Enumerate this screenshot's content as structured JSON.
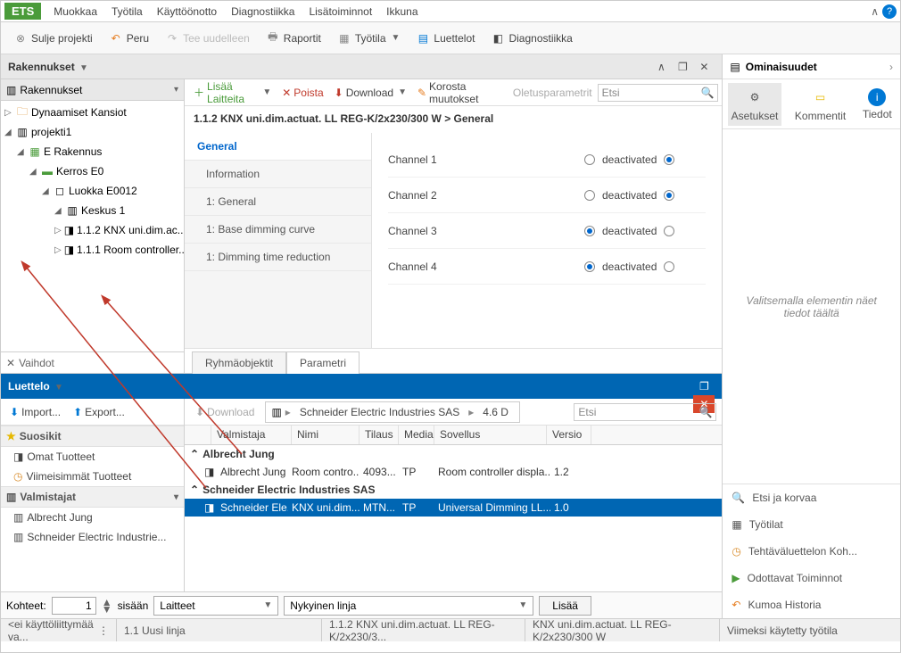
{
  "menubar": {
    "logo": "ETS",
    "items": [
      "Muokkaa",
      "Työtila",
      "Käyttöönotto",
      "Diagnostiikka",
      "Lisätoiminnot",
      "Ikkuna"
    ]
  },
  "toolbar": {
    "close": "Sulje projekti",
    "undo": "Peru",
    "redo": "Tee uudelleen",
    "reports": "Raportit",
    "workspace": "Työtila",
    "lists": "Luettelot",
    "diag": "Diagnostiikka"
  },
  "panel1_title": "Rakennukset",
  "tree_tb": {
    "add": "Lisää Laitteita",
    "delete": "Poista",
    "download": "Download",
    "highlight": "Korosta muutokset",
    "default": "Oletusparametrit"
  },
  "tree_hdr": "Rakennukset",
  "tree": {
    "dyn": "Dynaamiset Kansiot",
    "proj": "projekti1",
    "build": "E Rakennus",
    "floor": "Kerros E0",
    "room": "Luokka E0012",
    "center": "Keskus 1",
    "dev1": "1.1.2 KNX uni.dim.ac...",
    "dev2": "1.1.1 Room controller..."
  },
  "vaihdot": "Vaihdot",
  "search_ph": "Etsi",
  "crumb_main": "1.1.2 KNX uni.dim.actuat. LL REG-K/2x230/300 W > General",
  "pnav": [
    "General",
    "Information",
    "1: General",
    "1: Base dimming curve",
    "1: Dimming time reduction"
  ],
  "params": [
    {
      "name": "Channel 1",
      "r1": false,
      "label": "deactivated",
      "r2": true
    },
    {
      "name": "Channel 2",
      "r1": false,
      "label": "deactivated",
      "r2": true
    },
    {
      "name": "Channel 3",
      "r1": true,
      "label": "deactivated",
      "r2": false
    },
    {
      "name": "Channel 4",
      "r1": true,
      "label": "deactivated",
      "r2": false
    }
  ],
  "tabs": {
    "group": "Ryhmäobjektit",
    "param": "Parametri"
  },
  "luettelo": {
    "title": "Luettelo",
    "import": "Import...",
    "export": "Export...",
    "download": "Download",
    "crumb1": "Schneider Electric Industries SAS",
    "crumb2": "4.6 D",
    "fav_hdr": "Suosikit",
    "own": "Omat Tuotteet",
    "recent": "Viimeisimmät Tuotteet",
    "manu_hdr": "Valmistajat",
    "m1": "Albrecht Jung",
    "m2": "Schneider Electric Industrie...",
    "cols": [
      "Valmistaja",
      "Nimi",
      "Tilaus",
      "Media",
      "Sovellus",
      "Versio"
    ],
    "g1": "Albrecht Jung",
    "r1": [
      "Albrecht Jung",
      "Room contro...",
      "4093...",
      "TP",
      "Room controller displa...",
      "1.2"
    ],
    "g2": "Schneider Electric Industries SAS",
    "r2": [
      "Schneider Ele...",
      "KNX uni.dim....",
      "MTN...",
      "TP",
      "Universal Dimming LL...",
      "1.0"
    ]
  },
  "footer": {
    "kohteet": "Kohteet:",
    "count": "1",
    "sis": "sisään",
    "combo1": "Laitteet",
    "combo2": "Nykyinen linja",
    "add": "Lisää"
  },
  "status": {
    "s1": "<ei käyttöliittymää va...",
    "s2": "1.1 Uusi linja",
    "s3": "1.1.2 KNX uni.dim.actuat. LL REG-K/2x230/3...",
    "s4": "KNX uni.dim.actuat. LL REG-K/2x230/300 W",
    "s5": "Viimeksi käytetty työtila"
  },
  "props": {
    "title": "Ominaisuudet",
    "settings": "Asetukset",
    "comments": "Kommentit",
    "info": "Tiedot",
    "placeholder": "Valitsemalla elementin näet tiedot täältä"
  },
  "rlinks": [
    "Etsi ja korvaa",
    "Työtilat",
    "Tehtäväluettelon Koh...",
    "Odottavat Toiminnot",
    "Kumoa Historia"
  ]
}
